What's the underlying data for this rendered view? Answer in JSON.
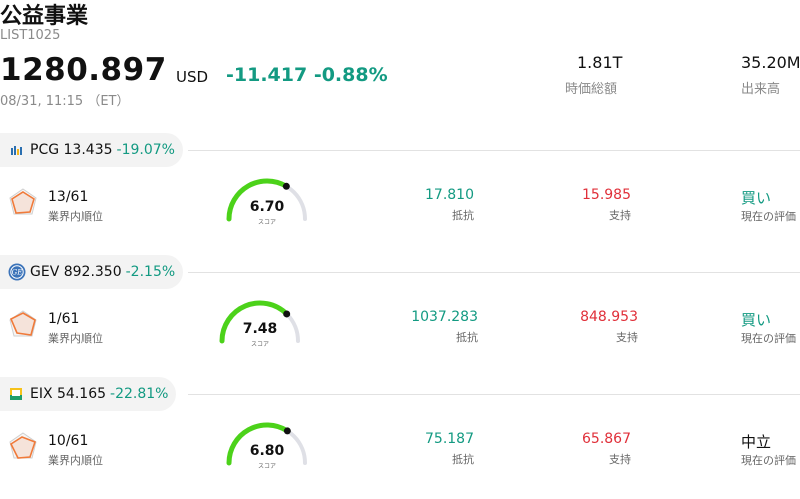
{
  "header": {
    "title": "公益事業",
    "code": "LIST1025",
    "price": "1280.897",
    "currency": "USD",
    "change": "-11.417 -0.88%",
    "datetime": "08/31, 11:15 （ET）",
    "market_cap_value": "1.81T",
    "market_cap_label": "時価総額",
    "volume_value": "35.20M",
    "volume_label": "出来高"
  },
  "colors": {
    "up": "#139a82",
    "down": "#e0303a",
    "gauge": "#4cd21a",
    "gauge_track": "#dfe0e6",
    "radar": "#f07a3a"
  },
  "stocks": [
    {
      "ticker": "PCG 13.435",
      "pct": "-19.07%",
      "logo_icon": "pcg-logo-icon",
      "rank": "13/61",
      "rank_label": "業界内順位",
      "score": "6.70",
      "score_fraction": 0.67,
      "score_label": "スコア",
      "resistance": "17.810",
      "resistance_label": "抵抗",
      "support": "15.985",
      "support_label": "支持",
      "rating": "買い",
      "rating_color": "#139a82",
      "rating_label": "現在の評価"
    },
    {
      "ticker": "GEV 892.350",
      "pct": "-2.15%",
      "logo_icon": "gev-logo-icon",
      "rank": "1/61",
      "rank_label": "業界内順位",
      "score": "7.48",
      "score_fraction": 0.748,
      "score_label": "スコア",
      "resistance": "1037.283",
      "resistance_label": "抵抗",
      "support": "848.953",
      "support_label": "支持",
      "rating": "買い",
      "rating_color": "#139a82",
      "rating_label": "現在の評価"
    },
    {
      "ticker": "EIX 54.165",
      "pct": "-22.81%",
      "logo_icon": "eix-logo-icon",
      "rank": "10/61",
      "rank_label": "業界内順位",
      "score": "6.80",
      "score_fraction": 0.68,
      "score_label": "スコア",
      "resistance": "75.187",
      "resistance_label": "抵抗",
      "support": "65.867",
      "support_label": "支持",
      "rating": "中立",
      "rating_color": "#111111",
      "rating_label": "現在の評価"
    }
  ]
}
